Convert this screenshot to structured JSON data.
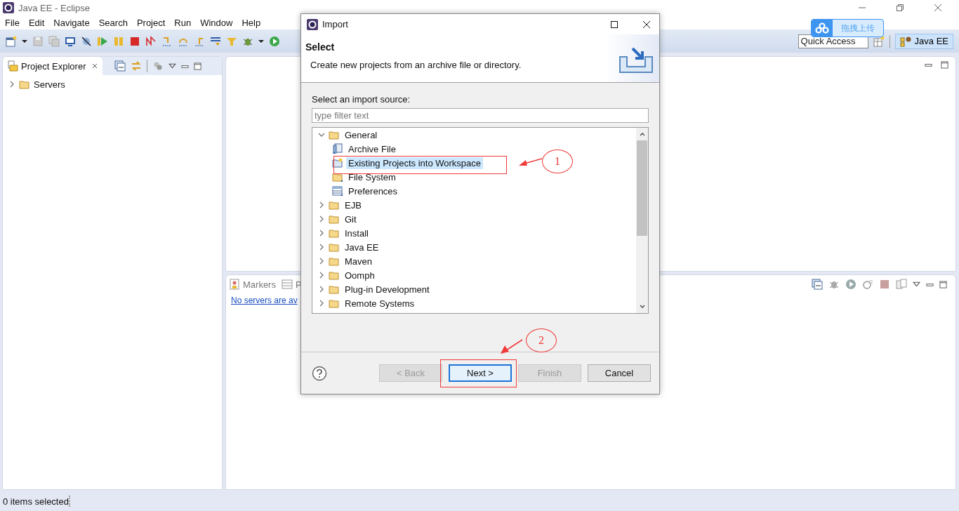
{
  "window": {
    "title": "Java EE - Eclipse"
  },
  "menu": [
    "File",
    "Edit",
    "Navigate",
    "Search",
    "Project",
    "Run",
    "Window",
    "Help"
  ],
  "quick_access": {
    "placeholder": "Quick Access"
  },
  "perspective": {
    "label": "Java EE",
    "selected": true
  },
  "upload_widget": {
    "label": "拖拽上传"
  },
  "project_explorer": {
    "tab": "Project Explorer",
    "items": [
      {
        "label": "Servers",
        "expanded": false
      }
    ]
  },
  "bottom_panel": {
    "tabs": [
      "Markers",
      "P"
    ],
    "link": "No servers are av"
  },
  "status_bar": {
    "text": "0 items selected"
  },
  "dialog": {
    "title": "Import",
    "heading": "Select",
    "description": "Create new projects from an archive file or directory.",
    "source_label": "Select an import source:",
    "filter": {
      "placeholder": "type filter text"
    },
    "tree": [
      {
        "label": "General",
        "kind": "folder",
        "expanded": true,
        "selected": false,
        "children": [
          {
            "label": "Archive File",
            "kind": "archive",
            "selected": false
          },
          {
            "label": "Existing Projects into Workspace",
            "kind": "project",
            "selected": true
          },
          {
            "label": "File System",
            "kind": "filesystem",
            "selected": false
          },
          {
            "label": "Preferences",
            "kind": "preferences",
            "selected": false
          }
        ]
      },
      {
        "label": "EJB",
        "kind": "folder",
        "expanded": false,
        "selected": false
      },
      {
        "label": "Git",
        "kind": "folder",
        "expanded": false,
        "selected": false
      },
      {
        "label": "Install",
        "kind": "folder",
        "expanded": false,
        "selected": false
      },
      {
        "label": "Java EE",
        "kind": "folder",
        "expanded": false,
        "selected": false
      },
      {
        "label": "Maven",
        "kind": "folder",
        "expanded": false,
        "selected": false
      },
      {
        "label": "Oomph",
        "kind": "folder",
        "expanded": false,
        "selected": false
      },
      {
        "label": "Plug-in Development",
        "kind": "folder",
        "expanded": false,
        "selected": false
      },
      {
        "label": "Remote Systems",
        "kind": "folder",
        "expanded": false,
        "selected": false
      }
    ],
    "buttons": [
      {
        "label": "< Back",
        "disabled": true,
        "default": false
      },
      {
        "label": "Next >",
        "disabled": false,
        "default": true
      },
      {
        "label": "Finish",
        "disabled": true,
        "default": false
      },
      {
        "label": "Cancel",
        "disabled": false,
        "default": false
      }
    ]
  },
  "annotations": [
    {
      "number": "1"
    },
    {
      "number": "2"
    }
  ]
}
